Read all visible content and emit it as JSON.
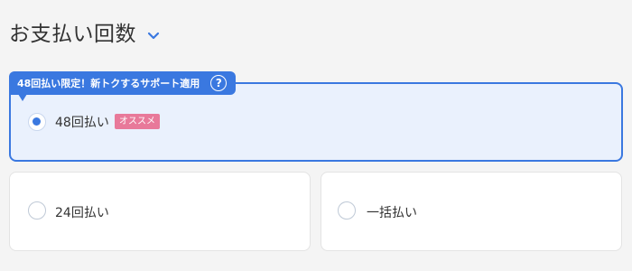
{
  "header": {
    "title": "お支払い回数",
    "check_icon": "chevron-down-icon",
    "accent_color": "#3a78e0"
  },
  "promo": {
    "text": "48回払い限定！新トクするサポート適用",
    "help_icon_label": "?",
    "help_icon": "question-circle-icon"
  },
  "options": [
    {
      "label": "48回払い",
      "selected": true,
      "badge": "オススメ"
    },
    {
      "label": "24回払い",
      "selected": false
    },
    {
      "label": "一括払い",
      "selected": false
    }
  ],
  "colors": {
    "accent": "#3a78e0",
    "badge": "#e8799a",
    "selected_background": "#eaf1fd"
  }
}
